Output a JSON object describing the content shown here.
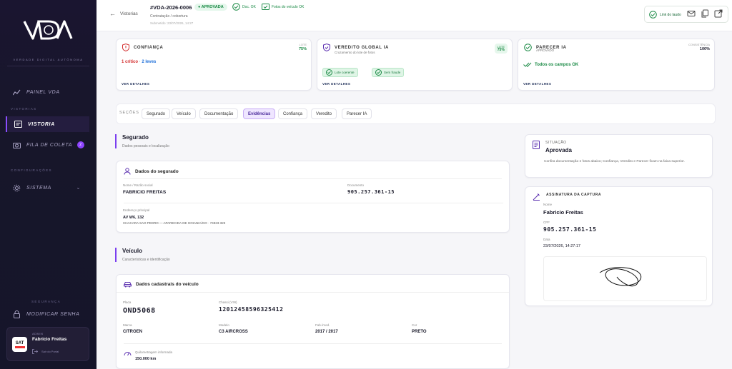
{
  "sidebar": {
    "tagline": "VERDADE DIGITAL AUTÔNOMA",
    "items": [
      {
        "label": "PAINEL VDA",
        "icon": "chart-icon"
      },
      {
        "label": "VISTORIA",
        "icon": "document-icon"
      },
      {
        "label": "FILA DE COLETA",
        "icon": "camera-icon",
        "badge": "2"
      },
      {
        "label": "SISTEMA",
        "icon": "gear-icon"
      },
      {
        "label": "MODIFICAR SENHA",
        "icon": "lock-icon"
      }
    ],
    "sections": [
      "VISTORIAS",
      "CONFIGURAÇÕES",
      "SEGURANÇA"
    ],
    "user": {
      "role": "ADMIN",
      "name": "Fabricio Freitas",
      "avatar": "SAT",
      "logout": "Sair do Portal"
    }
  },
  "header": {
    "back": "Vistorias",
    "id": "#VDA-2026-0006",
    "status": "APROVADA",
    "check1": "Doc. OK",
    "check2": "Fotos do veículo OK",
    "subtitle": "Contratação / cobertura",
    "meta": "Submetido: 23/07/2026, 14:27",
    "laudo": "Link do laudo"
  },
  "summary": {
    "confianca": {
      "title": "CONFIANÇA",
      "pct_label": "LOTE",
      "pct": "75%",
      "critico": "1 crítico",
      "leves": "2 leves",
      "sep": "·",
      "link": "VER DETALHES"
    },
    "veredito": {
      "title": "VEREDITO GLOBAL IA",
      "sub": "Cruzamento do lote de fotos",
      "pct_label": "LOTE",
      "pct": "75%",
      "chip1": "Lote coerente",
      "chip2": "Sem fraude",
      "link": "VER DETALHES"
    },
    "parecer": {
      "title": "PARECER IA",
      "sub": "APROVADO",
      "pct_label": "CONSISTÊNCIA",
      "pct": "100%",
      "ok": "Todos os campos OK",
      "link": "VER DETALHES"
    }
  },
  "tabs": {
    "label": "SEÇÕES",
    "items": [
      "Segurado",
      "Veículo",
      "Documentação",
      "Evidências",
      "Confiança",
      "Veredito",
      "Parecer IA"
    ],
    "active": 3
  },
  "segurado": {
    "title": "Segurado",
    "sub": "Dados pessoais e localização",
    "card": "Dados do segurado",
    "nome_lbl": "Nome / Razão social",
    "nome": "FABRICIO FREITAS",
    "doc_lbl": "Documento",
    "doc": "905.257.361-15",
    "end_lbl": "Endereço principal",
    "end1": "AV W6, 132",
    "end2": "CHACARA SAO PEDRO — APARECIDA DE GOIANIA/GO · 74923-323"
  },
  "veiculo": {
    "title": "Veículo",
    "sub": "Características e identificação",
    "card": "Dados cadastrais do veículo",
    "placa_lbl": "Placa",
    "placa": "OND5068",
    "chassi_lbl": "Chassi (VIN)",
    "chassi": "12012458596325412",
    "marca_lbl": "Marca",
    "marca": "CITROEN",
    "modelo_lbl": "Modelo",
    "modelo": "C3 AIRCROSS",
    "ano_lbl": "Fab./mod.",
    "ano": "2017 / 2017",
    "cor_lbl": "Cor",
    "cor": "PRETO",
    "km_lbl": "Quilometragem informada",
    "km": "150.000 km"
  },
  "situacao": {
    "label": "SITUAÇÃO",
    "value": "Aprovada",
    "text": "Confira documentação e fotos abaixo; Confiança, Veredito e Parecer ficam na faixa superior."
  },
  "assinatura": {
    "label": "ASSINATURA DA CAPTURA",
    "nome_lbl": "Nome",
    "nome": "Fabricio Freitas",
    "cpf_lbl": "CPF",
    "cpf": "905.257.361-15",
    "data_lbl": "Data",
    "data": "23/07/2026, 14:27:17"
  },
  "colors": {
    "accent": "#7a3ef0",
    "success": "#1a8a45",
    "danger": "#d32f2f",
    "sidebar": "#17162a"
  }
}
